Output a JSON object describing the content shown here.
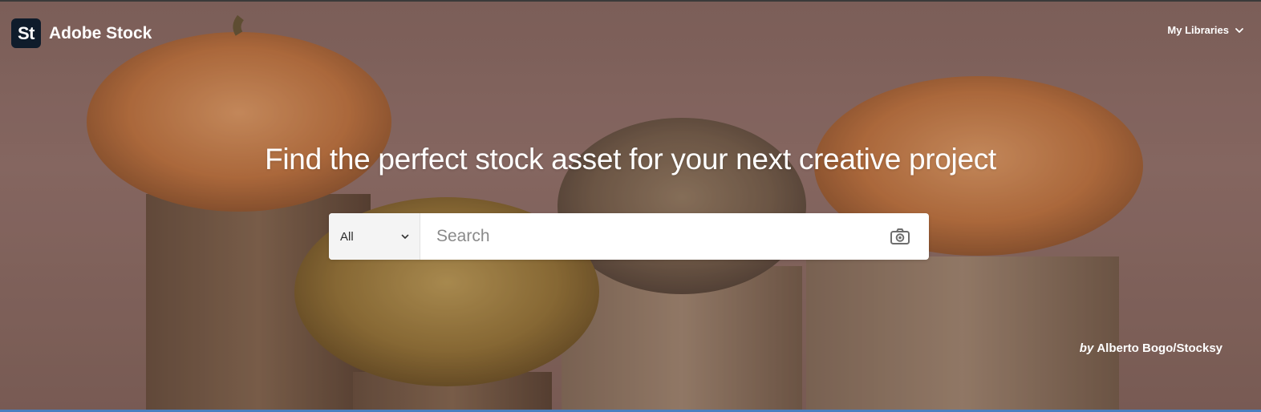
{
  "header": {
    "logo_text": "St",
    "brand_name": "Adobe Stock",
    "libraries_label": "My Libraries"
  },
  "hero": {
    "headline": "Find the perfect stock asset for your next creative project",
    "credit_prefix": "by",
    "credit_name": "Alberto Bogo/Stocksy"
  },
  "search": {
    "scope_value": "All",
    "placeholder": "Search",
    "value": ""
  },
  "icons": {
    "libraries_chevron": "chevron-down-icon",
    "scope_chevron": "chevron-down-icon",
    "visual_search": "camera-icon"
  },
  "colors": {
    "background": "#9a7872",
    "logo_bg": "#0f1c2b",
    "search_bg": "#ffffff",
    "scope_bg": "#f4f4f4",
    "text_on_photo": "#ffffff"
  }
}
